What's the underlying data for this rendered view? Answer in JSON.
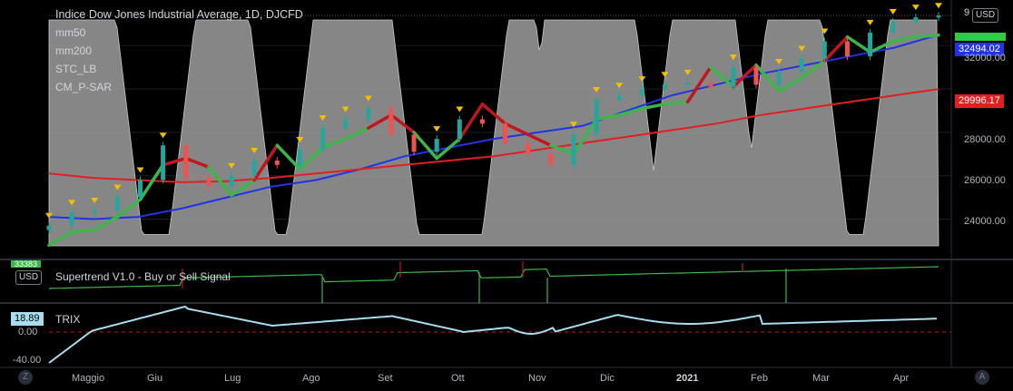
{
  "legend": {
    "title": "Indice Dow Jones Industrial Average, 1D, DJCFD",
    "indicators": [
      "mm50",
      "mm200",
      "STC_LB",
      "CM_P-SAR"
    ]
  },
  "currency_button": "USD",
  "panes": {
    "supertrend": {
      "label": "Supertrend V1.0 - Buy or Sell Signal",
      "currency_button": "USD",
      "badge": "33383"
    },
    "trix": {
      "label": "TRIX",
      "value_badge": "18.89"
    }
  },
  "price_tags": {
    "top": "9",
    "mm50": "32494.02",
    "mm200": "29996.17",
    "last": "33383"
  },
  "colors": {
    "mm50": "#2133e6",
    "mm200": "#e02020",
    "supertrend_up": "#3cb64a",
    "supertrend_down": "#c0161e",
    "stc_fill": "#9e9e9e",
    "trix": "#a8dcef",
    "sar": "#f2c000",
    "candle_up": "#26a69a",
    "candle_down": "#ef5350"
  },
  "icons": {
    "bottom_left": "Z",
    "bottom_right": "A"
  },
  "chart_data": [
    {
      "type": "line",
      "title": "Indice Dow Jones Industrial Average, 1D, DJCFD",
      "x_ticks": [
        "Maggio",
        "Giu",
        "Lug",
        "Ago",
        "Set",
        "Ott",
        "Nov",
        "Dic",
        "2021",
        "Feb",
        "Mar",
        "Apr"
      ],
      "y_ticks": [
        24000,
        26000,
        28000,
        30000,
        32000
      ],
      "ylim": [
        22600,
        33600
      ],
      "series": [
        {
          "name": "mm50",
          "values": [
            24100,
            24000,
            24100,
            24500,
            25000,
            25500,
            25800,
            26300,
            26900,
            27300,
            27700,
            28000,
            28300,
            29000,
            29700,
            30200,
            30700,
            31100,
            31500,
            31900,
            32494
          ]
        },
        {
          "name": "mm200",
          "values": [
            26100,
            25900,
            25800,
            25700,
            25750,
            25900,
            26100,
            26300,
            26500,
            26700,
            26900,
            27200,
            27500,
            27800,
            28100,
            28400,
            28800,
            29100,
            29400,
            29700,
            29996
          ]
        }
      ],
      "close": [
        23700,
        24300,
        24400,
        25000,
        25800,
        27400,
        25900,
        25500,
        26000,
        26700,
        26500,
        27200,
        28200,
        28600,
        29100,
        27900,
        27100,
        27700,
        28600,
        28400,
        27500,
        27000,
        26500,
        27900,
        29500,
        29700,
        30000,
        30200,
        30300,
        30100,
        31000,
        30200,
        30800,
        31400,
        32200,
        31500,
        32600,
        33100,
        33300,
        33383
      ]
    },
    {
      "type": "line",
      "title": "TRIX",
      "y_ticks": [
        0.0,
        -40.0
      ],
      "last_value": 18.89
    }
  ]
}
